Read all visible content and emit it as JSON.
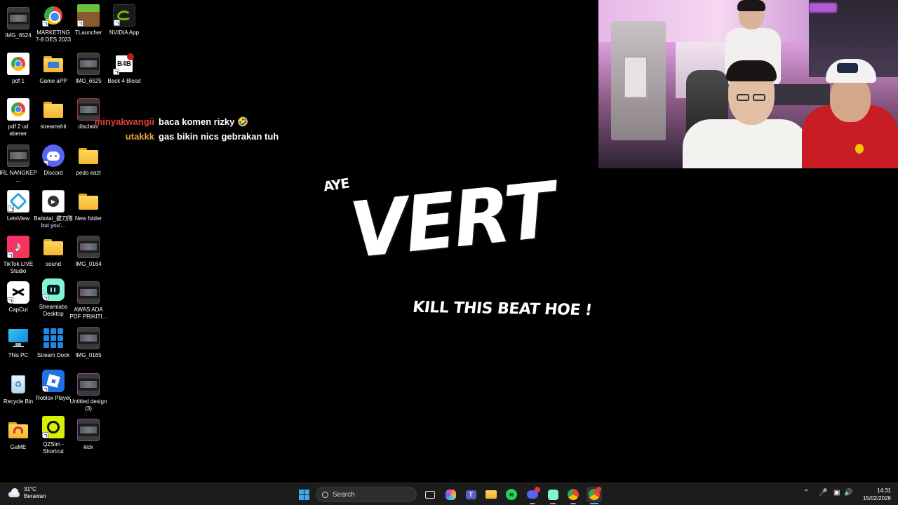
{
  "desktop_icons": {
    "img6524": "IMG_6524",
    "marketing": "MARKETING 7-8 DES 2023",
    "tlauncher": "TLauncher",
    "nvidia": "NVIDIA App",
    "pdf1": "pdf 1",
    "gameapp": "Game aPP",
    "img6525": "IMG_6525",
    "back4blood": "Back 4 Blood",
    "pdf2": "pdf 2 ud abener",
    "streamshit": "streamshit",
    "disclaimer": "disclaim",
    "irl": "IRL NANGKEP ...",
    "discord": "Discord",
    "pedoeazt": "pedo eazt",
    "letsview": "LetsView",
    "battotai": "Battotai_拔刀隊 but you'...",
    "newfolder": "New folder",
    "tiktok": "TikTok LIVE Studio",
    "sound": "sound",
    "img0164": "IMG_0164",
    "capcut": "CapCut",
    "streamlabs": "Streamlabs Desktop",
    "awas": "AWAS ADA PDF PRIKITI...",
    "thispc": "This PC",
    "streamdock": "Stream Dock",
    "img0165": "IMG_0165",
    "recyclebin": "Recycle Bin",
    "roblox": "Roblox Player",
    "untitled": "Untitled design (3)",
    "game": "GaME",
    "qzsim": "QZSim - Shortcut",
    "kick": "kick"
  },
  "chat": {
    "messages": [
      {
        "user": "minyakwangii",
        "text": "baca komen rizky 🤣",
        "color": "#e0413b"
      },
      {
        "user": "utakkk",
        "text": "gas bikin nics gebrakan tuh",
        "color": "#e8a43a"
      }
    ]
  },
  "overlay": {
    "aye": "AYE",
    "title": "VERT",
    "subtitle": "KILL THIS BEAT HOE !"
  },
  "taskbar": {
    "weather_temp": "31°C",
    "weather_desc": "Berawan",
    "search_placeholder": "Search",
    "time": "14:31",
    "date": "15/02/2026"
  },
  "colors": {
    "accent": "#0078d4",
    "taskbar_bg": "#1c1c1c"
  }
}
